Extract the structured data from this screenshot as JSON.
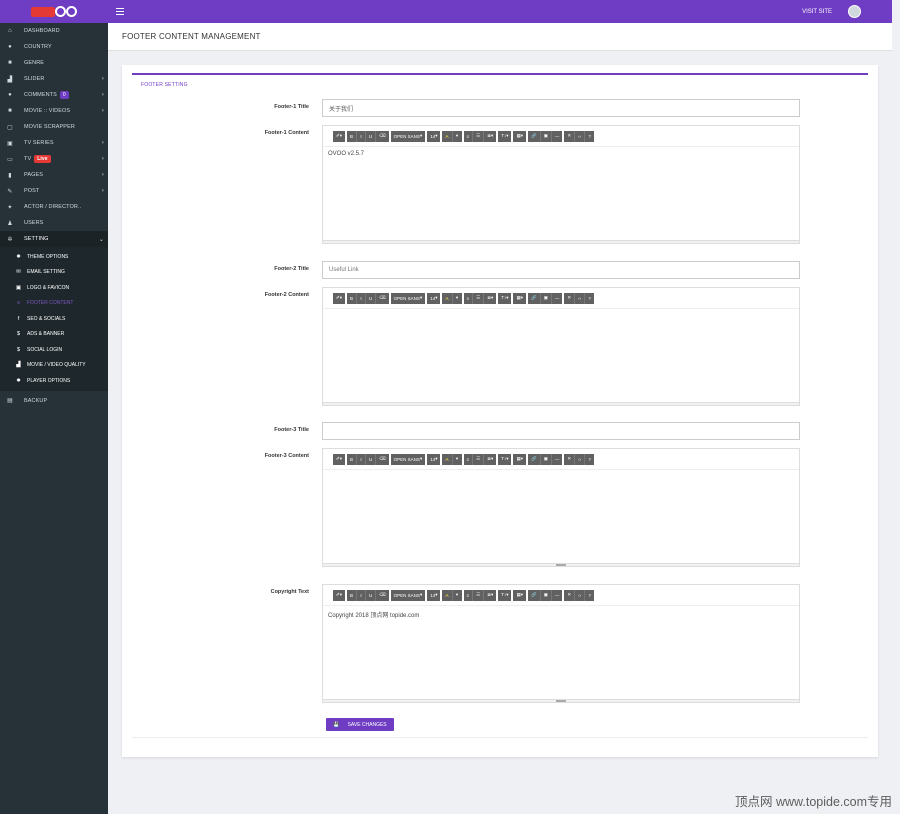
{
  "topbar": {
    "visit_site": "VISIT SITE"
  },
  "sidebar": {
    "items": [
      {
        "label": "DASHBOARD",
        "icon": "home-icon"
      },
      {
        "label": "COUNTRY",
        "icon": "globe-icon"
      },
      {
        "label": "GENRE",
        "icon": "archive-icon"
      },
      {
        "label": "SLIDER",
        "icon": "slider-icon",
        "chevron": true
      },
      {
        "label": "COMMENTS",
        "icon": "comment-icon",
        "badge": "0",
        "chevron": true
      },
      {
        "label": "MOVIE :: VIDEOS",
        "icon": "video-icon",
        "chevron": true
      },
      {
        "label": "MOVIE SCRAPPER",
        "icon": "copy-icon"
      },
      {
        "label": "TV SERIES",
        "icon": "film-icon",
        "chevron": true
      },
      {
        "label": "TV",
        "icon": "tv-icon",
        "badge": "Live",
        "chevron": true
      },
      {
        "label": "PAGES",
        "icon": "file-icon",
        "chevron": true
      },
      {
        "label": "POST",
        "icon": "edit-icon",
        "chevron": true
      },
      {
        "label": "ACTOR / DIRECTOR..",
        "icon": "users-icon"
      },
      {
        "label": "USERS",
        "icon": "user-icon"
      },
      {
        "label": "SETTING",
        "icon": "gears-icon"
      }
    ],
    "sub_items": [
      {
        "label": "THEME OPTIONS",
        "icon": "gear-icon"
      },
      {
        "label": "EMAIL SETTING",
        "icon": "envelope-icon"
      },
      {
        "label": "LOGO & FAVICON",
        "icon": "image-icon"
      },
      {
        "label": "FOOTER CONTENT",
        "icon": "list-icon"
      },
      {
        "label": "SEO & SOCIALS",
        "icon": "facebook-icon"
      },
      {
        "label": "ADS & BANNER",
        "icon": "dollar-icon"
      },
      {
        "label": "SOCIAL LOGIN",
        "icon": "dollar-icon"
      },
      {
        "label": "MOVIE / VIDEO QUALITY",
        "icon": "signal-icon"
      },
      {
        "label": "PLAYER OPTIONS",
        "icon": "gear-icon"
      }
    ],
    "backup": "BACKUP"
  },
  "page": {
    "title": "FOOTER CONTENT MANAGEMENT",
    "card_heading": "FOOTER SETTING"
  },
  "form": {
    "footer1_title_label": "Footer-1 Title",
    "footer1_title_value": "关于我们",
    "footer1_content_label": "Footer-1 Content",
    "footer1_content_value": "OVOO v2.5.7",
    "footer2_title_label": "Footer-2 Title",
    "footer2_title_value": "Useful Link",
    "footer2_content_label": "Footer-2 Content",
    "footer2_content_value": "",
    "footer3_title_label": "Footer-3 Title",
    "footer3_title_value": "",
    "footer3_content_label": "Footer-3 Content",
    "footer3_content_value": "",
    "copyright_label": "Copyright Text",
    "copyright_value": "Copyright 2018 顶点网 topide.com",
    "save_button": "SAVE CHANGES"
  },
  "toolbar": {
    "font_name": "OPEN SANS",
    "font_size": "14",
    "buttons": [
      "magic-icon",
      "bold-icon",
      "italic-icon",
      "underline-icon",
      "eraser-icon"
    ]
  },
  "watermark": "顶点网 www.topide.com专用"
}
